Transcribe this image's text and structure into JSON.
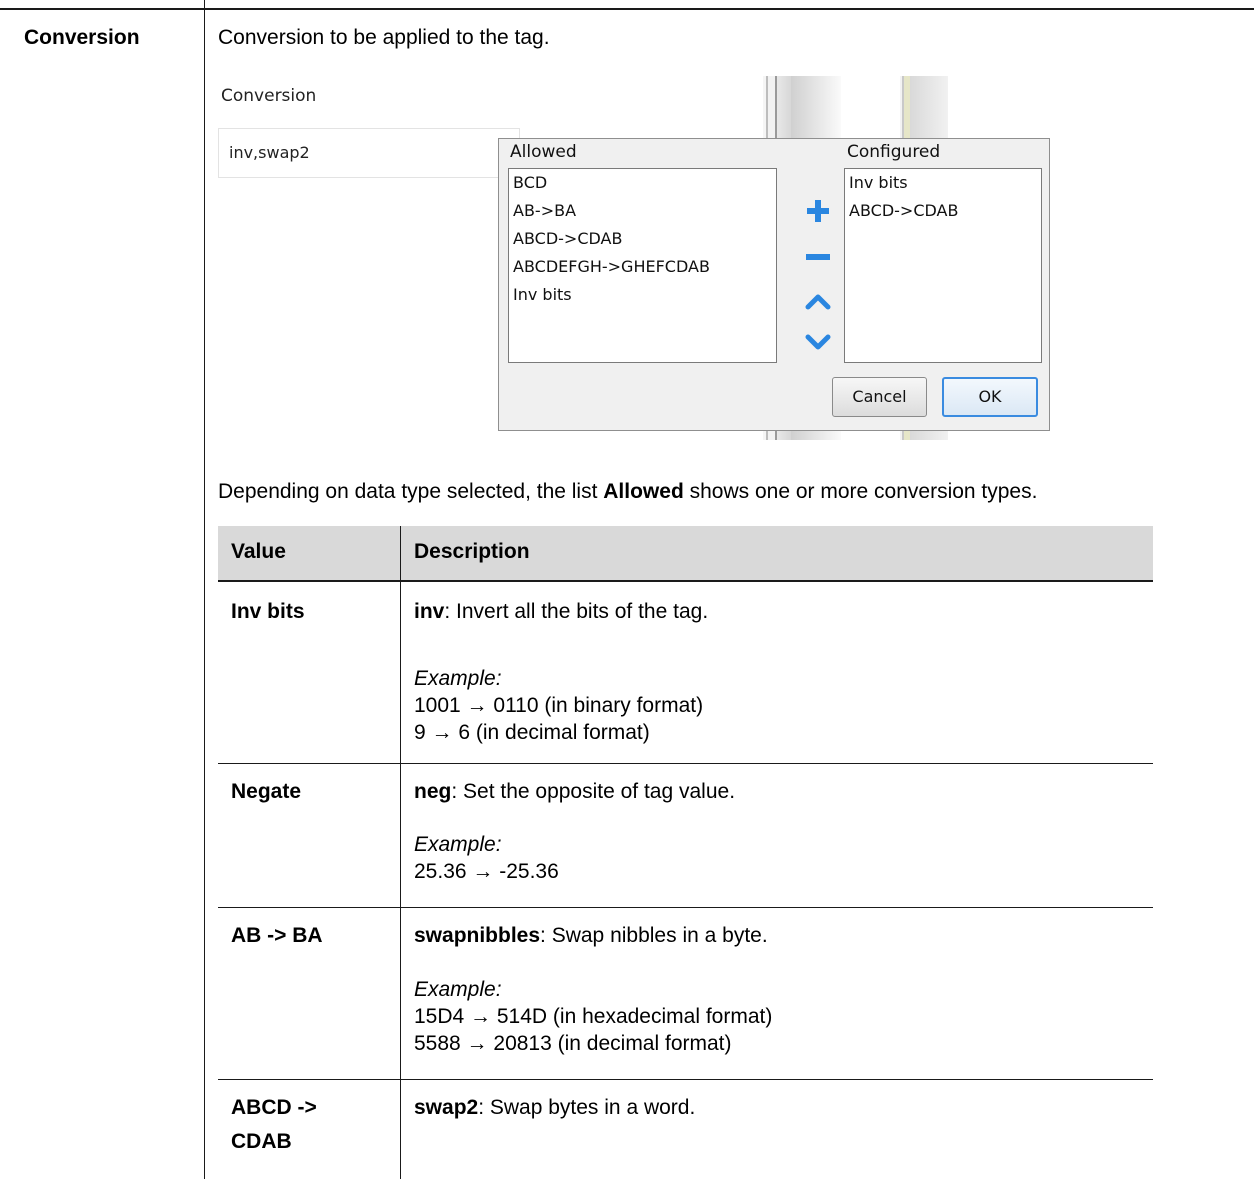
{
  "term": "Conversion",
  "intro": "Conversion to be applied to the tag.",
  "screenshot": {
    "field_label": "Conversion",
    "field_value": "inv,swap2",
    "allowed_label": "Allowed",
    "configured_label": "Configured",
    "allowed_items": [
      "BCD",
      "AB->BA",
      "ABCD->CDAB",
      "ABCDEFGH->GHEFCDAB",
      "Inv bits"
    ],
    "configured_items": [
      "Inv bits",
      "ABCD->CDAB"
    ],
    "icons": [
      "plus-icon",
      "minus-icon",
      "chevron-up-icon",
      "chevron-down-icon"
    ],
    "cancel_label": "Cancel",
    "ok_label": "OK",
    "accent_color": "#2a86e0"
  },
  "note": {
    "prefix": "Depending on data type selected, the list ",
    "bold": "Allowed",
    "suffix": " shows one or more conversion types."
  },
  "table": {
    "headers": [
      "Value",
      "Description"
    ],
    "rows": [
      {
        "value": "Inv bits",
        "code": "inv",
        "desc": ": Invert all the bits of the tag.",
        "example_label": "Example:",
        "examples": [
          "1001 → 0110 (in binary format)",
          "9 → 6 (in decimal format)"
        ]
      },
      {
        "value": "Negate",
        "code": "neg",
        "desc": ": Set the opposite of tag value.",
        "example_label": "Example:",
        "examples": [
          "25.36 → -25.36"
        ]
      },
      {
        "value": "AB -> BA",
        "code": "swapnibbles",
        "desc": ": Swap nibbles in a byte.",
        "example_label": "Example:",
        "examples": [
          "15D4 → 514D (in hexadecimal format)",
          "5588 → 20813 (in decimal format)"
        ]
      },
      {
        "value_lines": [
          "ABCD ->",
          "CDAB"
        ],
        "code": "swap2",
        "desc": ": Swap bytes in a word."
      }
    ]
  }
}
